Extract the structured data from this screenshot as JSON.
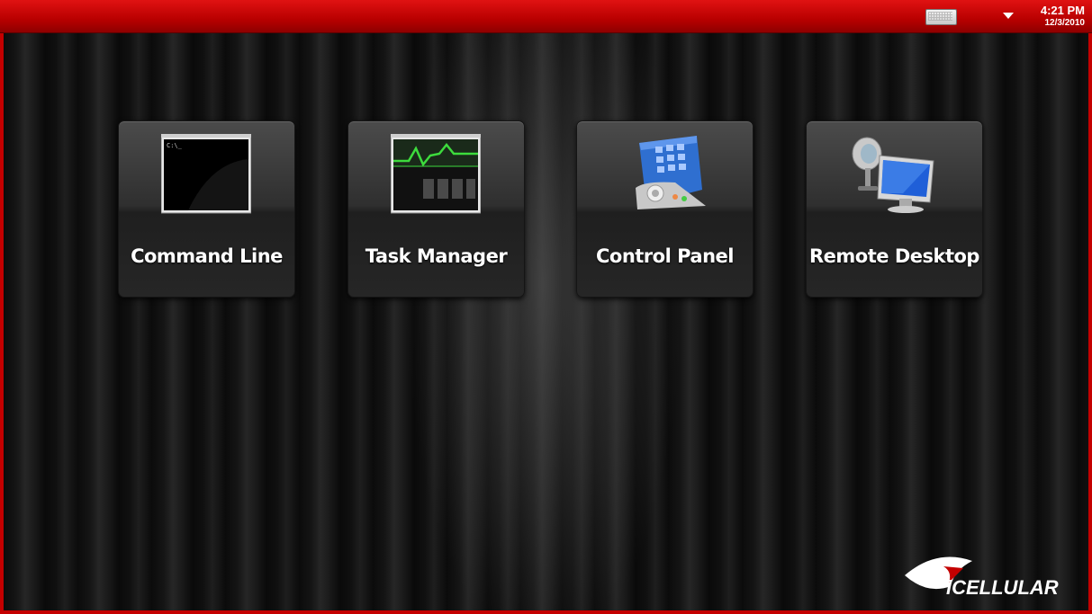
{
  "status_bar": {
    "time": "4:21 PM",
    "date": "12/3/2010",
    "keyboard_icon": "keyboard-icon",
    "menu_icon": "triangle-down-icon",
    "color": "#c40000"
  },
  "tiles": [
    {
      "label": "Command Line",
      "icon": "command-prompt-icon"
    },
    {
      "label": "Task Manager",
      "icon": "task-manager-icon"
    },
    {
      "label": "Control Panel",
      "icon": "control-panel-icon"
    },
    {
      "label": "Remote Desktop",
      "icon": "remote-desktop-icon"
    }
  ],
  "command_icon_text": "C:\\_",
  "brand": {
    "logo_text": "iCELLULAR"
  }
}
